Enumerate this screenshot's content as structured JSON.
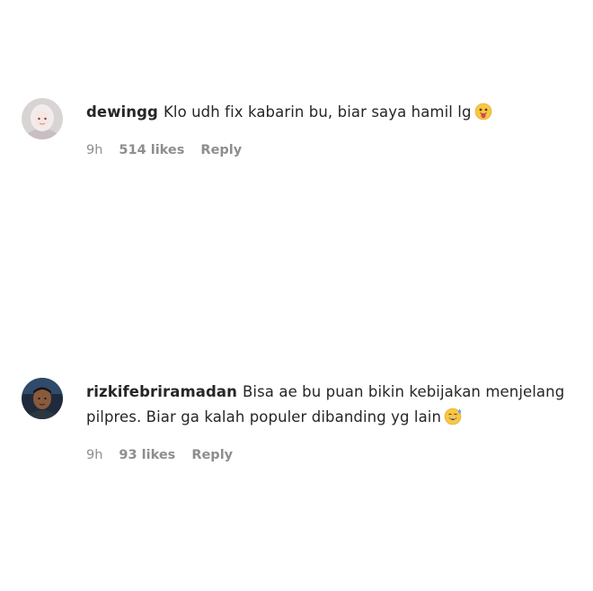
{
  "comments": [
    {
      "username": "dewingg",
      "text": "Klo udh fix kabarin bu, biar saya hamil lg",
      "emoji": "tongue-face-emoji",
      "time": "9h",
      "likes": "514 likes",
      "reply_label": "Reply"
    },
    {
      "username": "rizkifebriramadan",
      "text": "Bisa ae bu puan bikin kebijakan menjelang pilpres. Biar ga kalah populer dibanding yg lain",
      "emoji": "smiling-sweat-emoji",
      "time": "9h",
      "likes": "93 likes",
      "reply_label": "Reply"
    }
  ],
  "colors": {
    "text": "#262626",
    "meta": "#8e8e8e",
    "background": "#ffffff"
  }
}
